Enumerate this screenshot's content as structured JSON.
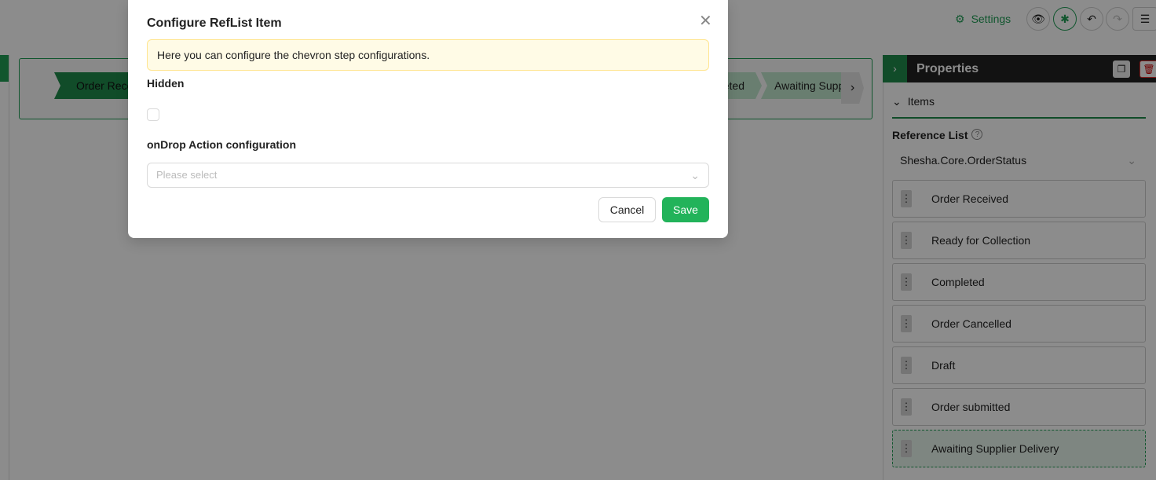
{
  "header": {
    "settings_label": "Settings",
    "icons": [
      "eye-icon",
      "bug-icon",
      "undo-icon",
      "redo-icon",
      "menu-icon"
    ]
  },
  "canvas": {
    "steps": [
      {
        "label": "Order Received",
        "active": true
      },
      {
        "label": "Completed"
      },
      {
        "label": "Awaiting Supplier Delivery"
      }
    ],
    "next_icon": "›"
  },
  "properties": {
    "title": "Properties",
    "section": "Items",
    "ref_list_label": "Reference List",
    "ref_list_value": "Shesha.Core.OrderStatus",
    "items": [
      "Order Received",
      "Ready for Collection",
      "Completed",
      "Order Cancelled",
      "Draft",
      "Order submitted",
      "Awaiting Supplier Delivery"
    ]
  },
  "modal": {
    "title": "Configure RefList Item",
    "info": "Here you can configure the chevron step configurations.",
    "hidden_label": "Hidden",
    "hidden_checked": false,
    "ondrop_label": "onDrop Action configuration",
    "ondrop_placeholder": "Please select",
    "cancel": "Cancel",
    "save": "Save"
  },
  "colors": {
    "accent": "#1f9d55",
    "primary_button": "#22b35a"
  }
}
